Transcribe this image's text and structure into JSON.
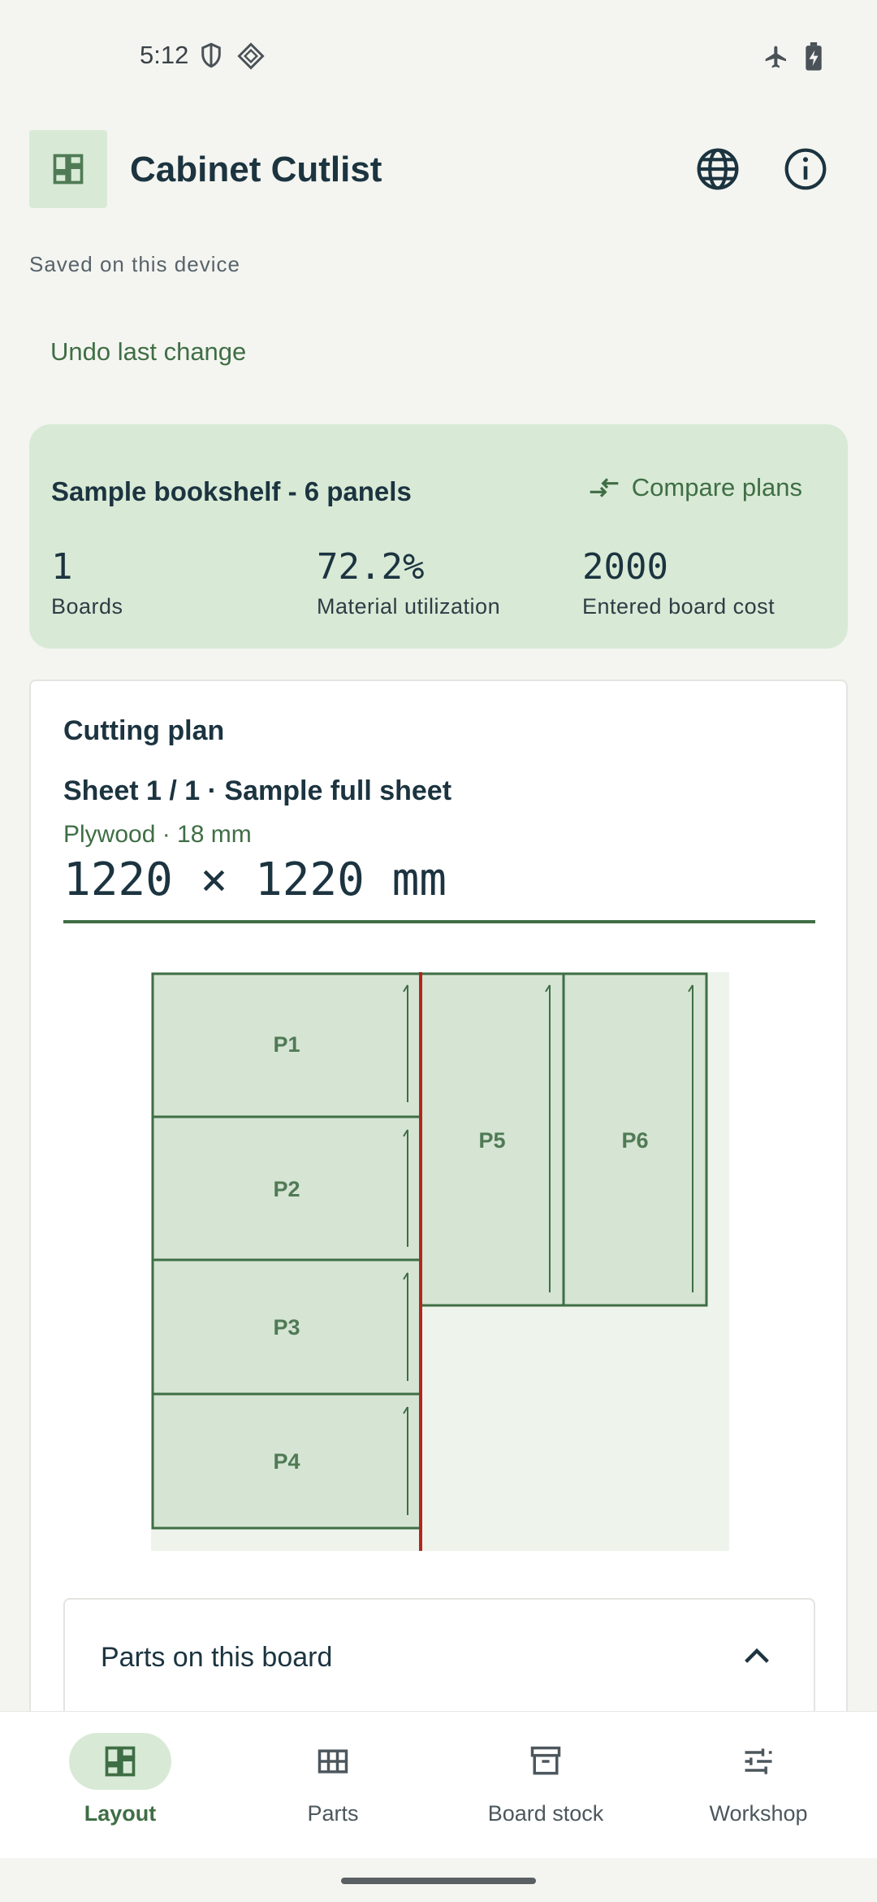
{
  "status_bar": {
    "time": "5:12"
  },
  "app_bar": {
    "title": "Cabinet Cutlist"
  },
  "save_status": "Saved on this device",
  "undo_label": "Undo last change",
  "summary": {
    "title": "Sample bookshelf - 6 panels",
    "compare_label": "Compare plans",
    "stats": [
      {
        "value": "1",
        "label": "Boards"
      },
      {
        "value": "72.2%",
        "label": "Material utilization"
      },
      {
        "value": "2000",
        "label": "Entered board cost"
      }
    ]
  },
  "cutting_plan": {
    "heading": "Cutting plan",
    "sheet_title": "Sheet 1 / 1 · Sample full sheet",
    "material": "Plywood · 18 mm",
    "dimensions": "1220 × 1220 mm",
    "parts": [
      {
        "label": "P1"
      },
      {
        "label": "P2"
      },
      {
        "label": "P3"
      },
      {
        "label": "P4"
      },
      {
        "label": "P5"
      },
      {
        "label": "P6"
      }
    ]
  },
  "parts_panel": {
    "title": "Parts on this board"
  },
  "bottom_nav": {
    "items": [
      {
        "label": "Layout",
        "icon": "dashboard-icon",
        "active": true
      },
      {
        "label": "Parts",
        "icon": "grid-icon",
        "active": false
      },
      {
        "label": "Board stock",
        "icon": "archive-icon",
        "active": false
      },
      {
        "label": "Workshop",
        "icon": "tune-icon",
        "active": false
      }
    ]
  },
  "colors": {
    "accent": "#3f6e45",
    "card_tint": "#d8ead6",
    "part_fill": "#d5e4d3",
    "sheet_fill": "#eef4ec",
    "cut_line": "#b3261e"
  }
}
